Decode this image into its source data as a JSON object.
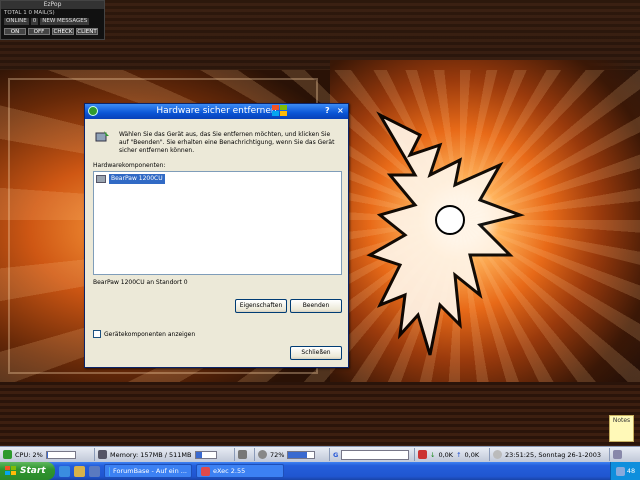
{
  "ezpop": {
    "title": "EzPop",
    "total_line": "TOTAL 1 0 MAIL(S)",
    "status": "ONLINE",
    "count": "0",
    "new_label": "NEW MESSAGES",
    "buttons": [
      "ON",
      "OFF",
      "CHECK",
      "CLIENT"
    ]
  },
  "dialog": {
    "title": "Hardware sicher entfernen",
    "help_label": "?",
    "close_label": "×",
    "intro": "Wählen Sie das Gerät aus, das Sie entfernen möchten, und klicken Sie auf \"Beenden\". Sie erhalten eine Benachrichtigung, wenn Sie das Gerät sicher entfernen können.",
    "components_label": "Hardwarekomponenten:",
    "items": [
      "BearPaw 1200CU"
    ],
    "device_location": "BearPaw 1200CU an Standort 0",
    "properties_button": "Eigenschaften",
    "stop_button": "Beenden",
    "show_components_label": "Gerätekomponenten anzeigen",
    "show_components_checked": false,
    "close_button": "Schließen"
  },
  "notes": {
    "label": "Notes"
  },
  "sysbar": {
    "cpu": "CPU: 2%",
    "cpu_percent": 2,
    "memory": "Memory: 157MB / 511MB",
    "memory_fraction": 0.31,
    "volume": "72%",
    "volume_percent": 72,
    "search_icon": "G",
    "net_down": "0,0K",
    "net_up": "0,0K",
    "clock": "23:51:25, Sonntag 26-1-2003"
  },
  "taskbar": {
    "start_label": "Start",
    "tasks": [
      {
        "label": "ForumBase - Auf ein ...",
        "icon": "browser-icon"
      },
      {
        "label": "eXec 2.55",
        "icon": "app-icon"
      }
    ],
    "tray_text": "48"
  },
  "colors": {
    "titlebar": "#0a55d6",
    "taskbar": "#245edb",
    "start": "#2f952f",
    "selection": "#316ac5",
    "wallpaper_glow": "#e86a18"
  }
}
